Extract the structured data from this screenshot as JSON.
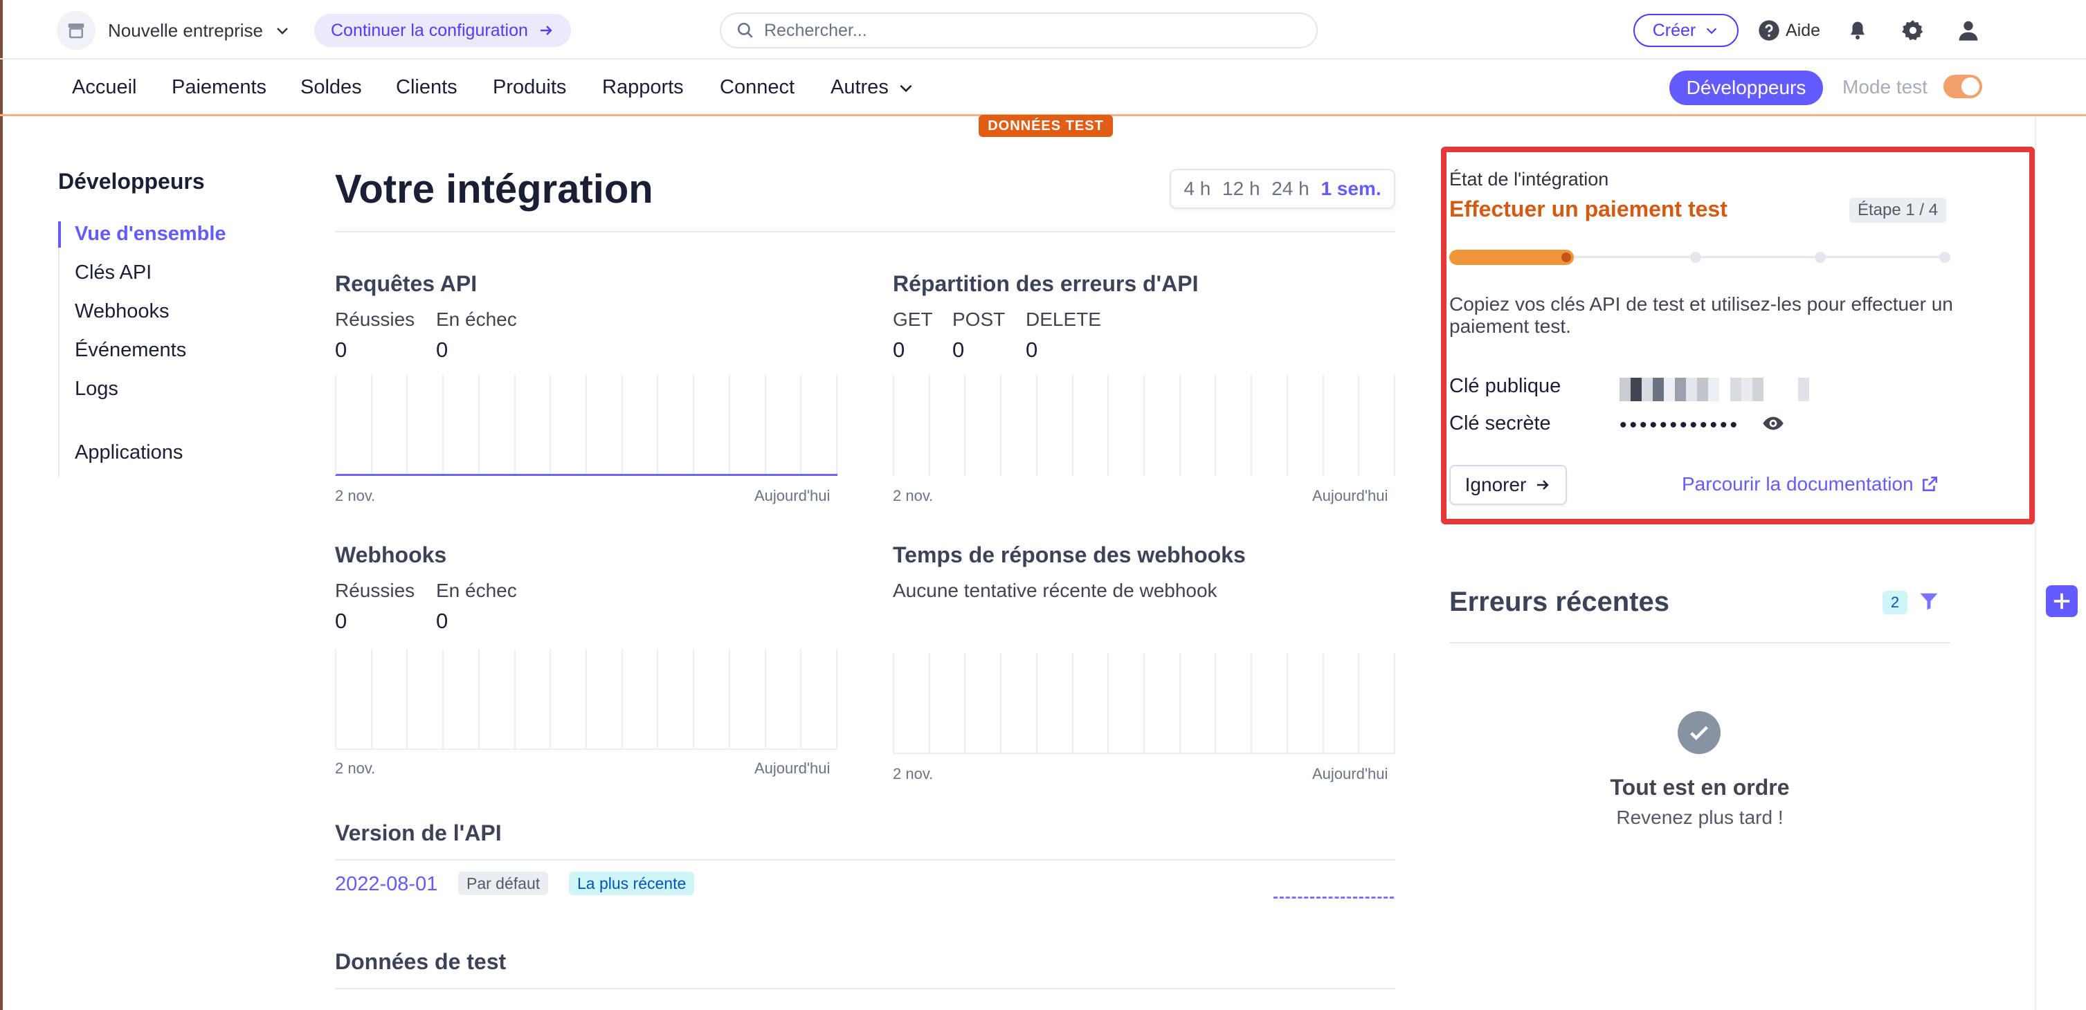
{
  "topbar": {
    "account_name": "Nouvelle entreprise",
    "continue_label": "Continuer la configuration",
    "search_placeholder": "Rechercher...",
    "create_label": "Créer",
    "help_label": "Aide"
  },
  "nav": {
    "items": [
      "Accueil",
      "Paiements",
      "Soldes",
      "Clients",
      "Produits",
      "Rapports",
      "Connect",
      "Autres"
    ],
    "developers_label": "Développeurs",
    "test_mode_label": "Mode test",
    "test_mode_on": true,
    "test_data_badge": "DONNÉES TEST"
  },
  "sidebar": {
    "title": "Développeurs",
    "items": [
      "Vue d'ensemble",
      "Clés API",
      "Webhooks",
      "Événements",
      "Logs"
    ],
    "active_index": 0,
    "extra_item": "Applications"
  },
  "main": {
    "title": "Votre intégration",
    "time_ranges": [
      "4 h",
      "12 h",
      "24 h",
      "1 sem."
    ],
    "selected_range": "1 sem.",
    "api_requests": {
      "title": "Requêtes API",
      "metrics": [
        {
          "label": "Réussies",
          "value": "0"
        },
        {
          "label": "En échec",
          "value": "0"
        }
      ],
      "axis_start": "2 nov.",
      "axis_end": "Aujourd'hui"
    },
    "api_errors": {
      "title": "Répartition des erreurs d'API",
      "metrics": [
        {
          "label": "GET",
          "value": "0"
        },
        {
          "label": "POST",
          "value": "0"
        },
        {
          "label": "DELETE",
          "value": "0"
        }
      ],
      "axis_start": "2 nov.",
      "axis_end": "Aujourd'hui"
    },
    "webhooks": {
      "title": "Webhooks",
      "metrics": [
        {
          "label": "Réussies",
          "value": "0"
        },
        {
          "label": "En échec",
          "value": "0"
        }
      ],
      "axis_start": "2 nov.",
      "axis_end": "Aujourd'hui"
    },
    "webhook_response": {
      "title": "Temps de réponse des webhooks",
      "empty_text": "Aucune tentative récente de webhook",
      "axis_start": "2 nov.",
      "axis_end": "Aujourd'hui"
    },
    "api_version": {
      "title": "Version de l'API",
      "version": "2022-08-01",
      "badge_default": "Par défaut",
      "badge_latest": "La plus récente"
    },
    "test_data": {
      "title": "Données de test"
    }
  },
  "integration": {
    "label": "État de l'intégration",
    "step_title": "Effectuer un paiement test",
    "step_badge": "Étape 1 / 4",
    "step_current": 1,
    "step_total": 4,
    "description": "Copiez vos clés API de test et utilisez-les pour effectuer un paiement test.",
    "public_key_label": "Clé publique",
    "secret_key_label": "Clé secrète",
    "secret_mask": "••••••••••••",
    "ignore_label": "Ignorer",
    "docs_label": "Parcourir la documentation"
  },
  "recent_errors": {
    "title": "Erreurs récentes",
    "filter_count": "2",
    "ok_title": "Tout est en ordre",
    "ok_subtitle": "Revenez plus tard !"
  },
  "colors": {
    "accent": "#635bff",
    "test_orange": "#e05d16",
    "highlight_red": "#e5383b"
  },
  "icons": [
    "store-icon",
    "chevron-down-icon",
    "arrow-right-icon",
    "search-icon",
    "help-icon",
    "bell-icon",
    "gear-icon",
    "user-icon",
    "eye-icon",
    "external-link-icon",
    "filter-icon",
    "check-icon",
    "plus-icon"
  ]
}
